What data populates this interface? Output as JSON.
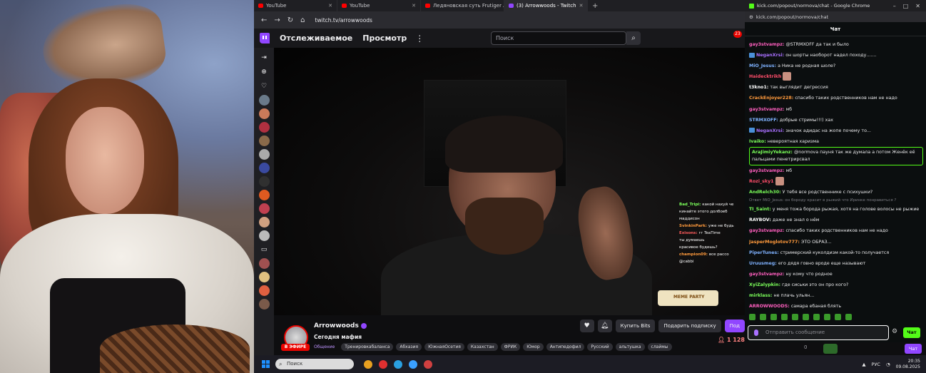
{
  "browser": {
    "tabs": [
      {
        "label": "YouTube",
        "icon": "youtube-icon"
      },
      {
        "label": "YouTube",
        "icon": "youtube-icon"
      },
      {
        "label": "Ледяновская суть Frutiger Aer...",
        "icon": "youtube-icon"
      },
      {
        "label": "(3) Arrowwoods - Twitch",
        "icon": "twitch-icon",
        "active": true
      }
    ],
    "url": "twitch.tv/arrowwoods"
  },
  "twitch": {
    "nav_following": "Отслеживаемое",
    "nav_browse": "Просмотр",
    "search_placeholder": "Поиск",
    "notif_count": "23",
    "video_chat": [
      {
        "user": "Bad_Tripi:",
        "text": "какой нахуй че",
        "color": "#7bff5a"
      },
      {
        "user": "",
        "text": "кинайте этого долбоеб",
        "color": "#ffffff"
      },
      {
        "user": "",
        "text": "маддисон",
        "color": "#ffffff"
      },
      {
        "user": "SvinkinPark:",
        "text": "уже не будь",
        "color": "#ff9a3c"
      },
      {
        "user": "Exisons:",
        "text": "гг TeaTime",
        "color": "#ff5c5c"
      },
      {
        "user": "",
        "text": "ты думаешь",
        "color": "#ffffff"
      },
      {
        "user": "",
        "text": "красивое будешь?",
        "color": "#ffffff"
      },
      {
        "user": "champion09:",
        "text": "все рассо",
        "color": "#ff9a3c"
      },
      {
        "user": "",
        "text": "@cabbi",
        "color": "#ffffff"
      }
    ],
    "meme_party": "MEME PARTY",
    "channel": {
      "name": "Arrowwoods",
      "title": "Сегодня мафия",
      "live_badge": "В ЭФИРЕ",
      "category": "Общение",
      "tags": [
        "Тренировкабаланса",
        "Абхазия",
        "ЮжнаяОсетия",
        "Казахстан",
        "ФРИК",
        "Юмор",
        "Антипедофил",
        "Русский",
        "альтушка",
        "слаймы"
      ],
      "viewers": "1 128",
      "btn_bits": "Купить Bits",
      "btn_gift": "Подарить подписку",
      "btn_follow": "Под"
    }
  },
  "kick": {
    "window_title": "kick.com/popout/normova/chat - Google Chrome",
    "url": "kick.com/popout/normova/chat",
    "header": "Чат",
    "messages": [
      {
        "user": "gay3stvampz:",
        "text": "@STRMXOFF да так и было",
        "color": "#ff5fbf"
      },
      {
        "user": "NeganXrsi:",
        "text": "он шорты наоборот надел походу.......",
        "color": "#a970ff",
        "badge": true
      },
      {
        "user": "MiO_Jesus:",
        "text": "а Ника не родная шоле?",
        "color": "#7fb2ff"
      },
      {
        "user": "Haidecktrikh",
        "text": "",
        "color": "#ff4d6a",
        "emote": true
      },
      {
        "user": "t3kno1:",
        "text": "так выглядит дегрессия",
        "color": "#ffffff"
      },
      {
        "user": "CrackEnjoyer228:",
        "text": "спасибо таких родственников нам не надо",
        "color": "#ff9a3c"
      },
      {
        "user": "gay3stvampz:",
        "text": "мб",
        "color": "#ff5fbf"
      },
      {
        "user": "STRMXOFF:",
        "text": "добрые стримы!!!) хах",
        "color": "#7fb2ff"
      },
      {
        "user": "NeganXrsi:",
        "text": "значок адидас на жопе почему то...",
        "color": "#a970ff",
        "badge": true
      },
      {
        "user": "Ivaiko:",
        "text": "невероятная харизма",
        "color": "#7bff5a"
      },
      {
        "user": "AraJimiyYekanz:",
        "text": "@normova пауня так же думала а потом Женёк её пальцами пенетрирсвал",
        "color": "#7bff5a",
        "highlight": true
      },
      {
        "user": "gay3stvampz:",
        "text": "мб",
        "color": "#ff5fbf"
      },
      {
        "user": "Rozi_sky1",
        "text": "",
        "color": "#ff4d6a",
        "emote": true
      },
      {
        "user": "AndRelch30:",
        "text": "У тебя все родственнике с психушки?",
        "color": "#7bff5a"
      },
      {
        "user": "",
        "text": "Ответ MiO_Jesus: он бороду красит в рыжий что Иринке понравиться ?",
        "reply": true
      },
      {
        "user": "TI_Saint:",
        "text": "у меня тожа борода рыжая, хотя на голове волосы не рыжие",
        "color": "#7bff5a"
      },
      {
        "user": "RAYBOV:",
        "text": "даже не знал о нём",
        "color": "#ffffff"
      },
      {
        "user": "gay3stvampz:",
        "text": "спасибо таких родственников нам не надо",
        "color": "#ff5fbf"
      },
      {
        "user": "JasperMoglotov777:",
        "text": "ЭТО ОБРАЗ...",
        "color": "#ff9a3c"
      },
      {
        "user": "PiperTunes:",
        "text": "стримерский куколдизм какой-то получается",
        "color": "#7fb2ff"
      },
      {
        "user": "Uruusmeg:",
        "text": "его дядя говно вроде еще называют",
        "color": "#7fb2ff"
      },
      {
        "user": "gay3stvampz:",
        "text": "ну кому что родное",
        "color": "#ff5fbf"
      },
      {
        "user": "XyiZalypkin:",
        "text": "где сиськи это он про кого?",
        "color": "#7bff5a"
      },
      {
        "user": "mirklass:",
        "text": "не плачь ульян...",
        "color": "#7bff5a"
      },
      {
        "user": "ARROWWOODS:",
        "text": "самара ебаная блять",
        "color": "#ff5fbf"
      }
    ],
    "input_placeholder": "Отправить сообщение",
    "send_label": "Чат",
    "points": "0",
    "bottom_chat": "Чат"
  },
  "taskbar": {
    "search_placeholder": "Поиск",
    "lang": "РУС",
    "time": "20:35",
    "date": "09.08.2025"
  }
}
